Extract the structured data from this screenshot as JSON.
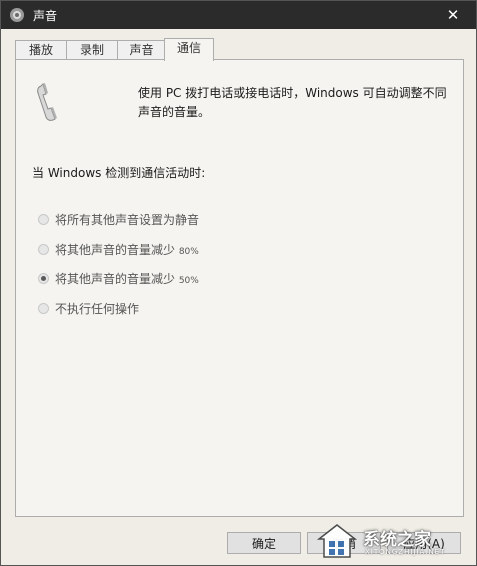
{
  "window": {
    "title": "声音",
    "close_glyph": "✕"
  },
  "tabs": [
    {
      "label": "播放"
    },
    {
      "label": "录制"
    },
    {
      "label": "声音"
    },
    {
      "label": "通信"
    }
  ],
  "active_tab": "通信",
  "content": {
    "description": "使用 PC 拨打电话或接电话时，Windows 可自动调整不同声音的音量。",
    "section_label": "当 Windows 检测到通信活动时:",
    "options": [
      {
        "label": "将所有其他声音设置为静音",
        "suffix": "",
        "selected": false
      },
      {
        "label": "将其他声音的音量减少 ",
        "suffix": "80%",
        "selected": false
      },
      {
        "label": "将其他声音的音量减少 ",
        "suffix": "50%",
        "selected": true
      },
      {
        "label": "不执行任何操作",
        "suffix": "",
        "selected": false
      }
    ]
  },
  "buttons": {
    "ok": "确定",
    "cancel": "取消",
    "apply": "应用(A)"
  },
  "watermark": {
    "text": "系统之家",
    "sub": "XITONGZHIJIA.NET"
  },
  "icons": {
    "title": "speaker-icon",
    "header": "phone-handset-icon"
  },
  "colors": {
    "titlebar": "#2b2b2b",
    "dialog_bg": "#f0ede6",
    "panel_bg": "#f5f4f0",
    "border": "#adadad"
  }
}
